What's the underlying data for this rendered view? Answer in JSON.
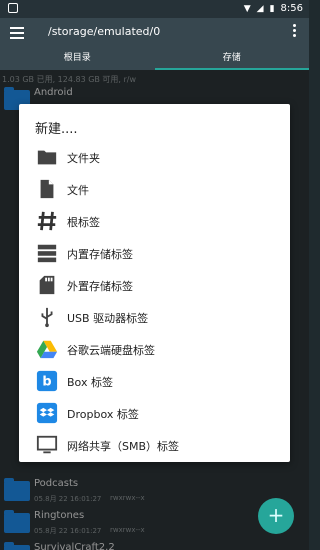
{
  "status_bar": {
    "time": "8:56"
  },
  "app_bar": {
    "path": "/storage/emulated/0"
  },
  "tabs": [
    {
      "label": "根目录"
    },
    {
      "label": "存储"
    }
  ],
  "storage_info": "1.03 GB 已用, 124.83 GB 可用, r/w",
  "files": [
    {
      "name": "Android",
      "meta": "",
      "perm": ""
    },
    {
      "name": "Podcasts",
      "meta": "05.8月 22 16:01:27",
      "perm": "rwxrwx--x"
    },
    {
      "name": "Ringtones",
      "meta": "05.8月 22 16:01:27",
      "perm": "rwxrwx--x"
    },
    {
      "name": "SurvivalCraft2.2",
      "meta": "",
      "perm": ""
    }
  ],
  "dialog": {
    "title": "新建....",
    "items": [
      {
        "label": "文件夹",
        "icon": "folder-icon"
      },
      {
        "label": "文件",
        "icon": "file-icon"
      },
      {
        "label": "根标签",
        "icon": "hashtag-icon"
      },
      {
        "label": "内置存储标签",
        "icon": "storage-icon"
      },
      {
        "label": "外置存储标签",
        "icon": "sd-card-icon"
      },
      {
        "label": "USB 驱动器标签",
        "icon": "usb-icon"
      },
      {
        "label": "谷歌云端硬盘标签",
        "icon": "google-drive-icon"
      },
      {
        "label": "Box 标签",
        "icon": "box-icon"
      },
      {
        "label": "Dropbox 标签",
        "icon": "dropbox-icon"
      },
      {
        "label": "网络共享（SMB）标签",
        "icon": "monitor-icon"
      }
    ]
  },
  "fab": {
    "label": "+"
  }
}
